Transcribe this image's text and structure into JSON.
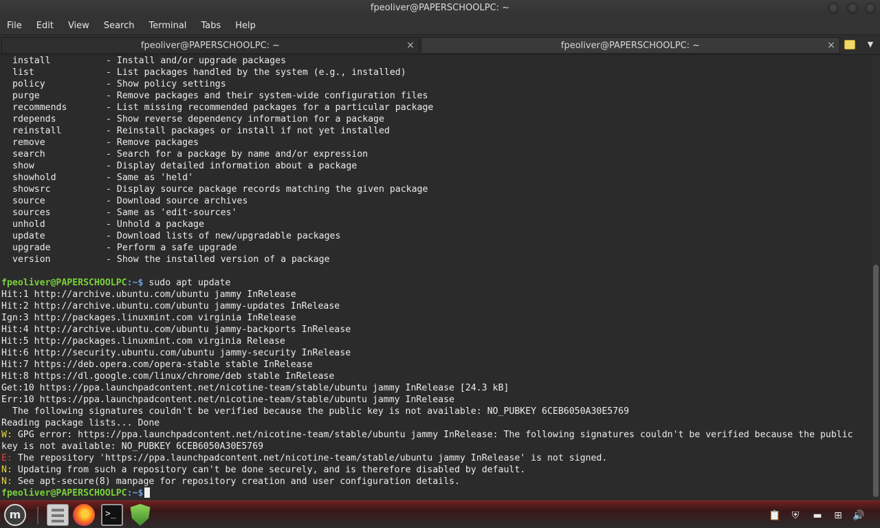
{
  "window": {
    "title": "fpeoliver@PAPERSCHOOLPC: ~"
  },
  "menu": [
    "File",
    "Edit",
    "View",
    "Search",
    "Terminal",
    "Tabs",
    "Help"
  ],
  "tabs": [
    {
      "label": "fpeoliver@PAPERSCHOOLPC: ~",
      "close": "×"
    },
    {
      "label": "fpeoliver@PAPERSCHOOLPC: ~",
      "close": "×"
    }
  ],
  "terminal": {
    "commands": [
      {
        "cmd": "install",
        "desc": "- Install and/or upgrade packages"
      },
      {
        "cmd": "list",
        "desc": "- List packages handled by the system (e.g., installed)"
      },
      {
        "cmd": "policy",
        "desc": "- Show policy settings"
      },
      {
        "cmd": "purge",
        "desc": "- Remove packages and their system-wide configuration files"
      },
      {
        "cmd": "recommends",
        "desc": "- List missing recommended packages for a particular package"
      },
      {
        "cmd": "rdepends",
        "desc": "- Show reverse dependency information for a package"
      },
      {
        "cmd": "reinstall",
        "desc": "- Reinstall packages or install if not yet installed"
      },
      {
        "cmd": "remove",
        "desc": "- Remove packages"
      },
      {
        "cmd": "search",
        "desc": "- Search for a package by name and/or expression"
      },
      {
        "cmd": "show",
        "desc": "- Display detailed information about a package"
      },
      {
        "cmd": "showhold",
        "desc": "- Same as 'held'"
      },
      {
        "cmd": "showsrc",
        "desc": "- Display source package records matching the given package"
      },
      {
        "cmd": "source",
        "desc": "- Download source archives"
      },
      {
        "cmd": "sources",
        "desc": "- Same as 'edit-sources'"
      },
      {
        "cmd": "unhold",
        "desc": "- Unhold a package"
      },
      {
        "cmd": "update",
        "desc": "- Download lists of new/upgradable packages"
      },
      {
        "cmd": "upgrade",
        "desc": "- Perform a safe upgrade"
      },
      {
        "cmd": "version",
        "desc": "- Show the installed version of a package"
      }
    ],
    "prompt_user": "fpeoliver@PAPERSCHOOLPC",
    "prompt_path": ":~$",
    "command1": " sudo apt update",
    "output": [
      "Hit:1 http://archive.ubuntu.com/ubuntu jammy InRelease",
      "Hit:2 http://archive.ubuntu.com/ubuntu jammy-updates InRelease",
      "Ign:3 http://packages.linuxmint.com virginia InRelease",
      "Hit:4 http://archive.ubuntu.com/ubuntu jammy-backports InRelease",
      "Hit:5 http://packages.linuxmint.com virginia Release",
      "Hit:6 http://security.ubuntu.com/ubuntu jammy-security InRelease",
      "Hit:7 https://deb.opera.com/opera-stable stable InRelease",
      "Hit:8 https://dl.google.com/linux/chrome/deb stable InRelease",
      "Get:10 https://ppa.launchpadcontent.net/nicotine-team/stable/ubuntu jammy InRelease [24.3 kB]",
      "Err:10 https://ppa.launchpadcontent.net/nicotine-team/stable/ubuntu jammy InRelease",
      "  The following signatures couldn't be verified because the public key is not available: NO_PUBKEY 6CEB6050A30E5769",
      "Reading package lists... Done"
    ],
    "warning_prefix": "W:",
    "warning_line1": " GPG error: https://ppa.launchpadcontent.net/nicotine-team/stable/ubuntu jammy InRelease: The following signatures couldn't be verified because the public",
    "warning_line2": "key is not available: NO_PUBKEY 6CEB6050A30E5769",
    "error_prefix": "E:",
    "error_line": " The repository 'https://ppa.launchpadcontent.net/nicotine-team/stable/ubuntu jammy InRelease' is not signed.",
    "notice_prefix": "N:",
    "notice_line1": " Updating from such a repository can't be done securely, and is therefore disabled by default.",
    "notice_line2": " See apt-secure(8) manpage for repository creation and user configuration details."
  },
  "taskbar": {
    "icons": [
      "linux-mint-menu-icon",
      "files-icon",
      "firefox-icon",
      "terminal-icon",
      "update-manager-shield-icon"
    ],
    "terminal_glyph": ">_",
    "tray": [
      "clipboard-icon",
      "shield-icon",
      "keyboard-icon",
      "network-icon",
      "volume-icon"
    ]
  },
  "colors": {
    "terminal_bg": "#2b2b2b",
    "prompt_user": "#7ad13b",
    "prompt_path": "#6f9fd8",
    "warning": "#e8d33f",
    "error": "#e04040"
  }
}
